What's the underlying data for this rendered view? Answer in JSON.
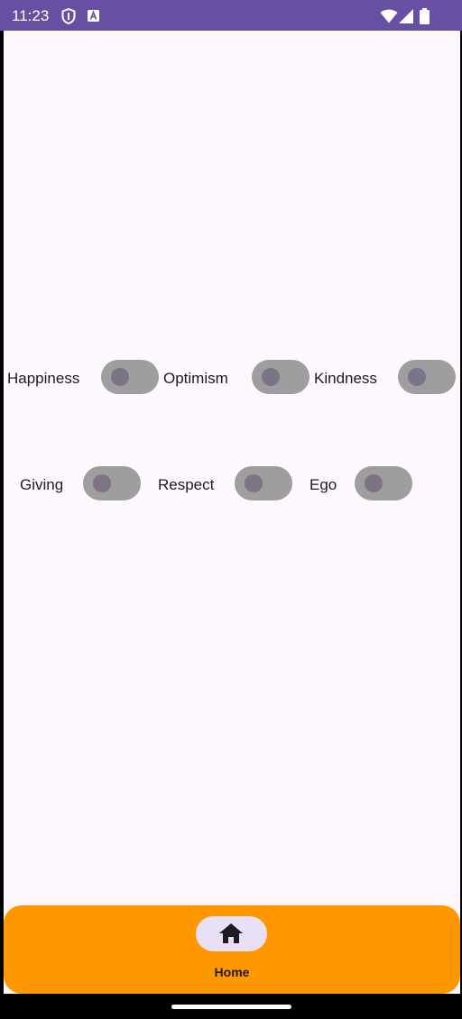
{
  "status_bar": {
    "time": "11:23",
    "background": "#6750a4",
    "icons": [
      "shield-icon",
      "a-badge-icon",
      "wifi-icon",
      "signal-icon",
      "battery-icon"
    ]
  },
  "switches": [
    {
      "label": "Happiness",
      "checked": false
    },
    {
      "label": "Optimism",
      "checked": false
    },
    {
      "label": "Kindness",
      "checked": false
    },
    {
      "label": "Giving",
      "checked": false
    },
    {
      "label": "Respect",
      "checked": false
    },
    {
      "label": "Ego",
      "checked": false
    }
  ],
  "bottom_nav": {
    "background": "#ff9800",
    "items": [
      {
        "label": "Home",
        "icon": "home-icon",
        "selected": true
      }
    ]
  },
  "colors": {
    "content_background": "#fef7fd",
    "switch_track": "#9e9e9e",
    "switch_thumb": "#7c7386",
    "nav_indicator": "#e9e0f7"
  }
}
